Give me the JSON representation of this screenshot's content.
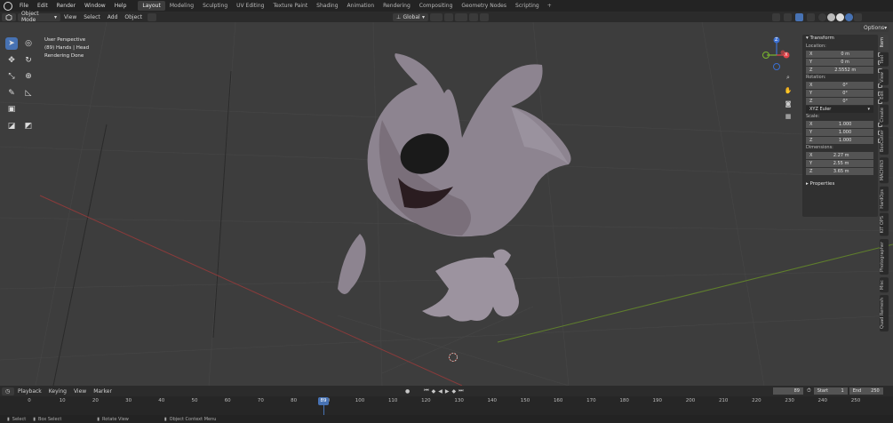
{
  "topbar": {
    "menus": [
      "File",
      "Edit",
      "Render",
      "Window",
      "Help"
    ],
    "workspaces": [
      "Layout",
      "Modeling",
      "Sculpting",
      "UV Editing",
      "Texture Paint",
      "Shading",
      "Animation",
      "Rendering",
      "Compositing",
      "Geometry Nodes",
      "Scripting"
    ],
    "active_workspace": "Layout",
    "plus": "+"
  },
  "header": {
    "mode": "Object Mode",
    "menus": [
      "View",
      "Select",
      "Add",
      "Object"
    ],
    "orientation": "Global",
    "options": "Options"
  },
  "viewport": {
    "info_line1": "User Perspective",
    "info_line2": "(89) Hands | Head",
    "info_line3": "Rendering Done",
    "axis_x": "X",
    "axis_y": "Y",
    "axis_z": "Z"
  },
  "npanel": {
    "transform_title": "Transform",
    "location_label": "Location:",
    "location": [
      {
        "axis": "X",
        "value": "0 m"
      },
      {
        "axis": "Y",
        "value": "0 m"
      },
      {
        "axis": "Z",
        "value": "2.5552 m"
      }
    ],
    "rotation_label": "Rotation:",
    "rotation": [
      {
        "axis": "X",
        "value": "0°"
      },
      {
        "axis": "Y",
        "value": "0°"
      },
      {
        "axis": "Z",
        "value": "0°"
      }
    ],
    "rotation_mode": "XYZ Euler",
    "scale_label": "Scale:",
    "scale": [
      {
        "axis": "X",
        "value": "1.000"
      },
      {
        "axis": "Y",
        "value": "1.000"
      },
      {
        "axis": "Z",
        "value": "1.000"
      }
    ],
    "dimensions_label": "Dimensions:",
    "dimensions": [
      {
        "axis": "X",
        "value": "2.27 m"
      },
      {
        "axis": "Y",
        "value": "2.55 m"
      },
      {
        "axis": "Z",
        "value": "3.65 m"
      }
    ],
    "properties_title": "Properties"
  },
  "vtabs": [
    "Item",
    "Tool",
    "View",
    "Edit",
    "Create",
    "BoxCutter",
    "MACHIN3",
    "HardOps",
    "KIT OPS",
    "Photographer",
    "Misc",
    "Quad Remesh"
  ],
  "timeline": {
    "menus": [
      "Playback",
      "Keying",
      "View",
      "Marker"
    ],
    "current_frame": "89",
    "start_label": "Start",
    "start": "1",
    "end_label": "End",
    "end": "250",
    "ticks": [
      "0",
      "10",
      "20",
      "30",
      "40",
      "50",
      "60",
      "70",
      "80",
      "90",
      "100",
      "110",
      "120",
      "130",
      "140",
      "150",
      "160",
      "170",
      "180",
      "190",
      "200",
      "210",
      "220",
      "230",
      "240",
      "250"
    ],
    "playhead": "89"
  },
  "status": {
    "items": [
      "Select",
      "Box Select",
      "Rotate View",
      "Object Context Menu"
    ]
  },
  "colors": {
    "accent": "#4772b3",
    "x_axis": "#e0444a",
    "y_axis": "#7ab82e",
    "z_axis": "#3b6fd1"
  }
}
